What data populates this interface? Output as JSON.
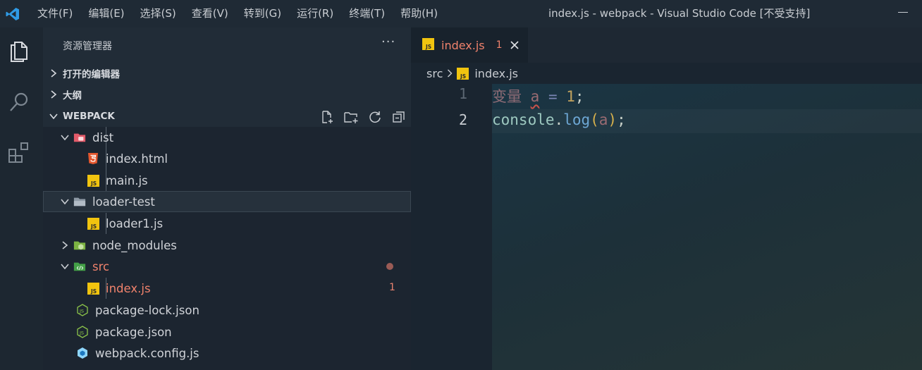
{
  "menu": [
    "文件(F)",
    "编辑(E)",
    "选择(S)",
    "查看(V)",
    "转到(G)",
    "运行(R)",
    "终端(T)",
    "帮助(H)"
  ],
  "window_title": "index.js - webpack - Visual Studio Code [不受支持]",
  "sidebar": {
    "header": "资源管理器",
    "more": "···",
    "sections": {
      "open_editors": "打开的编辑器",
      "outline": "大纲",
      "workspace": "WEBPACK"
    }
  },
  "tree": [
    {
      "label": "dist",
      "icon": "folder-dist-icon"
    },
    {
      "label": "index.html",
      "icon": "html5-icon"
    },
    {
      "label": "main.js",
      "icon": "js-file-icon"
    },
    {
      "label": "loader-test",
      "icon": "folder-icon"
    },
    {
      "label": "loader1.js",
      "icon": "js-file-icon"
    },
    {
      "label": "node_modules",
      "icon": "folder-node-icon"
    },
    {
      "label": "src",
      "icon": "folder-src-icon"
    },
    {
      "label": "index.js",
      "icon": "js-file-icon",
      "badge": "1"
    },
    {
      "label": "package-lock.json",
      "icon": "nodejs-icon"
    },
    {
      "label": "package.json",
      "icon": "nodejs-icon"
    },
    {
      "label": "webpack.config.js",
      "icon": "webpack-icon"
    }
  ],
  "editor": {
    "tab": {
      "label": "index.js",
      "problems": "1"
    },
    "breadcrumb": {
      "folder": "src",
      "file": "index.js"
    },
    "line_numbers": [
      "1",
      "2"
    ],
    "code": {
      "l1": {
        "kw": "变量",
        "var": "a",
        "op": " = ",
        "num": "1",
        "end": ";"
      },
      "l2": {
        "obj": "console",
        "dot": ".",
        "fn": "log",
        "open": "(",
        "arg": "a",
        "close": ")",
        "end": ";"
      }
    }
  },
  "colors": {
    "accent_js": "#f1c40f",
    "modified": "#f0826c",
    "titlebar": "#1f2a35",
    "sidebar": "#212c37"
  }
}
